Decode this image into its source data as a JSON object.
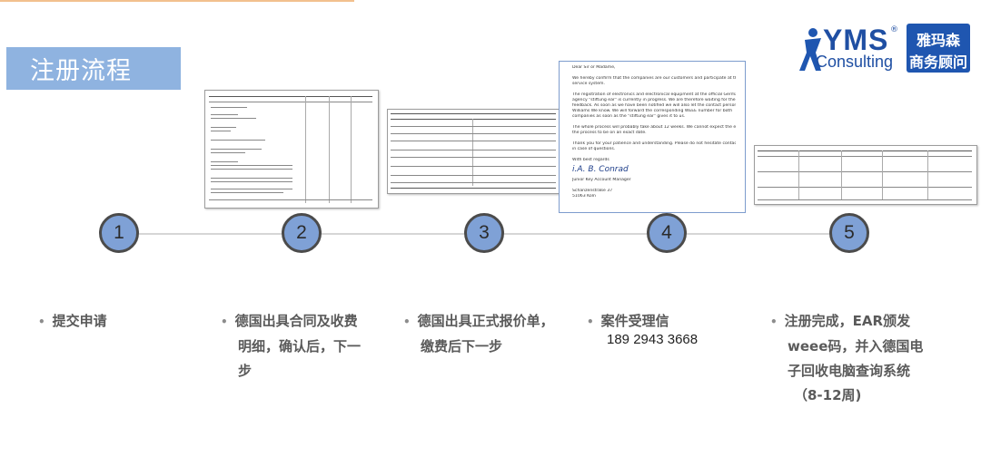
{
  "title": "注册流程",
  "logo": {
    "brand": "YMS",
    "sub": "Consulting",
    "reg": "®",
    "cn_line1": "雅玛森",
    "cn_line2": "商务顾问",
    "brand_color": "#1f56b0"
  },
  "colors": {
    "title_bg": "#8fb3e0",
    "circle_fill": "#7fa1d6",
    "timeline": "#d6d6d6",
    "step_text": "#5a5a5a"
  },
  "steps": [
    {
      "number": "1",
      "lines": [
        "提交申请"
      ]
    },
    {
      "number": "2",
      "lines": [
        "德国出具合同及收费",
        "明细，确认后，下一",
        "步"
      ]
    },
    {
      "number": "3",
      "lines": [
        "德国出具正式报价单，",
        "缴费后下一步"
      ]
    },
    {
      "number": "4",
      "lines": [
        "案件受理信"
      ],
      "phone": "189 2943 3668"
    },
    {
      "number": "5",
      "lines": [
        "注册完成，EAR颁发",
        "weee码，并入德国电",
        "子回收电脑查询系统",
        "（8-12周)"
      ]
    }
  ],
  "letter_doc": {
    "lines": [
      "Dear Sir or Madame,",
      "",
      "We hereby confirm that the companies are our customers and participate at the",
      "service system.",
      "",
      "The registration of electronics and electronical equipment at the official German",
      "agency \"stiftung ear\" is currently in progress. We are therefore waiting for their",
      "feedback. As soon as we have been notified we will also let the contact person Mr.",
      "Williams We know. We will forward the corresponding WEEE number for both",
      "companies as soon as the \"stiftung ear\" gives it to us.",
      "",
      "The whole process will probably take about 12 weeks. We cannot expect the end of",
      "the process to be on an exact date.",
      "",
      "Thank you for your patience and understanding. Please do not hesitate contacting us",
      "in case of questions.",
      "",
      "With best regards"
    ],
    "signature": "i.A. B. Conrad",
    "footer": [
      "Junior Key Account Manager",
      "",
      "Schanzenstraße 37",
      "51063 Köln"
    ]
  }
}
